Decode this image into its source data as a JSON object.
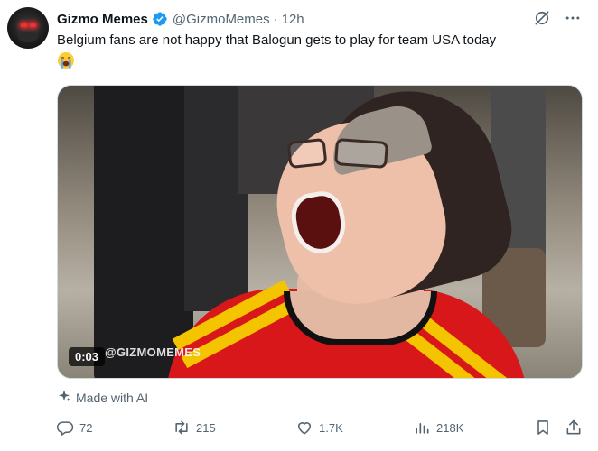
{
  "tweet": {
    "author_name": "Gizmo Memes",
    "handle": "@GizmoMemes",
    "separator": "·",
    "time": "12h",
    "text": "Belgium fans are not happy that Balogun gets to play for team USA today",
    "emoji": "loudly-crying-face",
    "verified": true
  },
  "media": {
    "watermark": "@GIZMOMEMES",
    "timecode": "0:03"
  },
  "label": {
    "made_with": "Made with AI"
  },
  "metrics": {
    "replies": "72",
    "reposts": "215",
    "likes": "1.7K",
    "views": "218K"
  },
  "icons": {
    "grok": "grok-icon",
    "more": "more-icon",
    "sparkle": "sparkle-icon",
    "reply": "reply-icon",
    "repost": "repost-icon",
    "like": "heart-icon",
    "views": "views-icon",
    "bookmark": "bookmark-icon",
    "share": "share-icon"
  },
  "colors": {
    "verified_blue": "#1d9bf0",
    "text_primary": "#0f1419",
    "text_secondary": "#536471"
  }
}
